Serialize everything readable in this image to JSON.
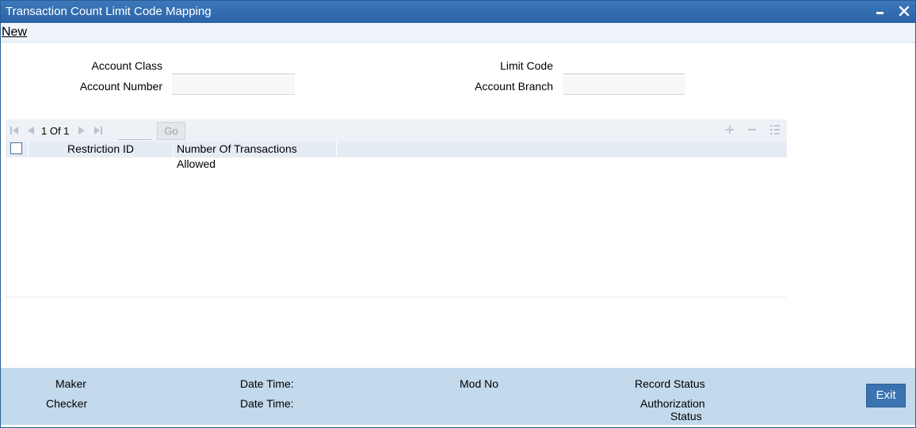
{
  "window": {
    "title": "Transaction Count Limit Code Mapping",
    "minimize_icon": "minimize-icon",
    "close_icon": "close-icon"
  },
  "menu": {
    "new_label": "New"
  },
  "form": {
    "account_class_label": "Account Class",
    "account_class_value": "",
    "account_number_label": "Account Number",
    "account_number_value": "",
    "limit_code_label": "Limit Code",
    "limit_code_value": "",
    "account_branch_label": "Account Branch",
    "account_branch_value": ""
  },
  "grid": {
    "page_info": "1 Of 1",
    "page_input_value": "",
    "go_label": "Go",
    "columns": [
      "Restriction ID",
      "Number Of Transactions Allowed"
    ],
    "rows": []
  },
  "footer": {
    "maker_label": "Maker",
    "checker_label": "Checker",
    "date_time_label_1": "Date Time:",
    "date_time_label_2": "Date Time:",
    "mod_no_label": "Mod No",
    "record_status_label": "Record Status",
    "authorization_label": "Authorization",
    "status_label": "Status",
    "exit_label": "Exit"
  },
  "colors": {
    "titlebar": "#2f6db2",
    "footer": "#c3d9ec",
    "exit_button": "#3b73b0"
  }
}
